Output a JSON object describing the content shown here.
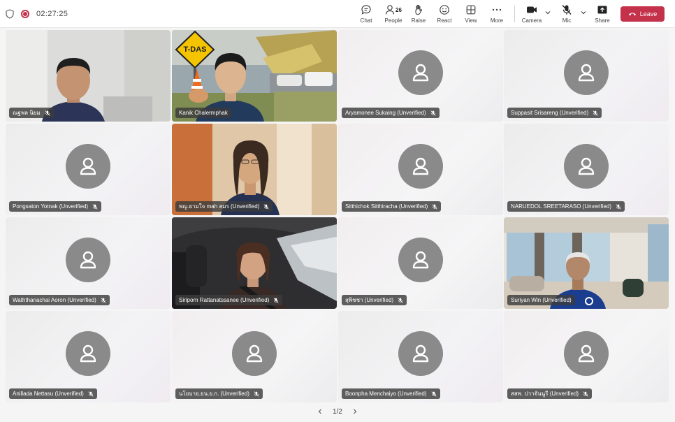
{
  "meeting": {
    "timer": "02:27:25"
  },
  "toolbar": {
    "chat": "Chat",
    "people": "People",
    "people_count": "26",
    "raise": "Raise",
    "react": "React",
    "view": "View",
    "more": "More",
    "camera": "Camera",
    "mic": "Mic",
    "share": "Share",
    "leave": "Leave"
  },
  "colors": {
    "leave": "#c4314b",
    "nameplate": "#3c3c3c",
    "avatar": "#8a8a8a"
  },
  "participants": [
    {
      "name": "ณฐพล นิยม",
      "video": true
    },
    {
      "name": "Kanik Chalermphak",
      "video": true
    },
    {
      "name": "Aryamonee Sukaing (Unverified)",
      "video": false
    },
    {
      "name": "Suppasit Srisareng (Unverified)",
      "video": false
    },
    {
      "name": "Pongsaton Yotnak (Unverified)",
      "video": false
    },
    {
      "name": "พญ.ยามใจ mah สมร (Unverified)",
      "video": true
    },
    {
      "name": "Sitthichok Sitthiracha (Unverified)",
      "video": false
    },
    {
      "name": "NARUEDOL SREETARASO (Unverified)",
      "video": false
    },
    {
      "name": "Waththanachai Aoron (Unverified)",
      "video": false
    },
    {
      "name": "Siriporn Rattanatssanee (Unverified)",
      "video": true
    },
    {
      "name": "สุพิชชา (Unverified)",
      "video": false
    },
    {
      "name": "Suriyan Win (Unverified)",
      "video": true
    },
    {
      "name": "Anillada Nettasu (Unverified)",
      "video": false
    },
    {
      "name": "นโยบาย.ยน.ย.ก. (Unverified)",
      "video": false
    },
    {
      "name": "Boonpha Menchaiyo (Unverified)",
      "video": false
    },
    {
      "name": "สสพ. ปวาจันนูรี (Unverified)",
      "video": false
    }
  ],
  "pager": {
    "label": "1/2"
  }
}
